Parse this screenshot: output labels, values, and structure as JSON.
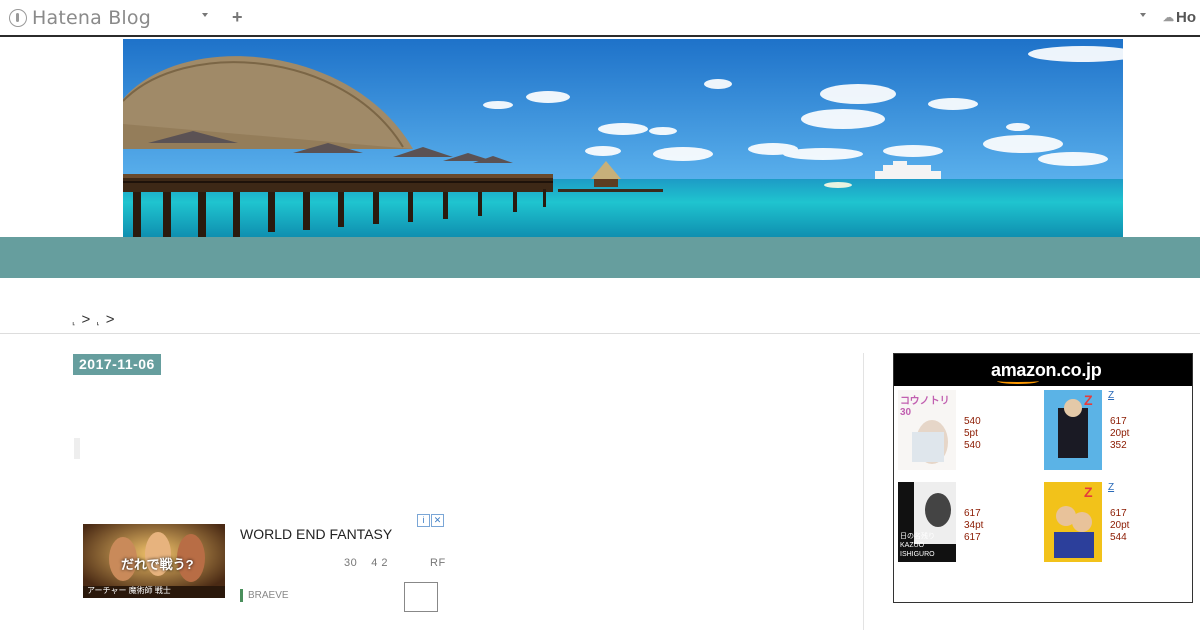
{
  "topbar": {
    "logo_text": "Hatena Blog",
    "right_logo_text": "Ho",
    "plus_label": "+"
  },
  "breadcrumb": {
    "items": [
      ">",
      ">"
    ]
  },
  "entry": {
    "date": "2017-11-06"
  },
  "ad": {
    "title": "WORLD END FANTASY",
    "desc": [
      "30",
      "4 2",
      "RF"
    ],
    "brand": "BRAEVE",
    "image_caption": "だれで戦う?",
    "image_sub": "アーチャー 魔術師 戦士",
    "adchoices_icon": "info-icon",
    "close_icon": "close-icon"
  },
  "amazon": {
    "logo_text": "amazon.co.jp",
    "items": [
      {
        "link": "",
        "prices": [
          "540",
          "5pt",
          "540"
        ],
        "cover_text": "コウノトリ 30"
      },
      {
        "link": "Z",
        "prices": [
          "617",
          "20pt",
          "352"
        ],
        "cover_text": "Z"
      },
      {
        "link": "",
        "prices": [
          "617",
          "34pt",
          "617"
        ],
        "cover_text": "日の名残り KAZUO ISHIGURO"
      },
      {
        "link": "Z",
        "prices": [
          "617",
          "20pt",
          "544"
        ],
        "cover_text": "Z"
      }
    ]
  },
  "colors": {
    "accent": "#669e9e",
    "price": "#8b1a00",
    "link": "#2a6ab8"
  }
}
